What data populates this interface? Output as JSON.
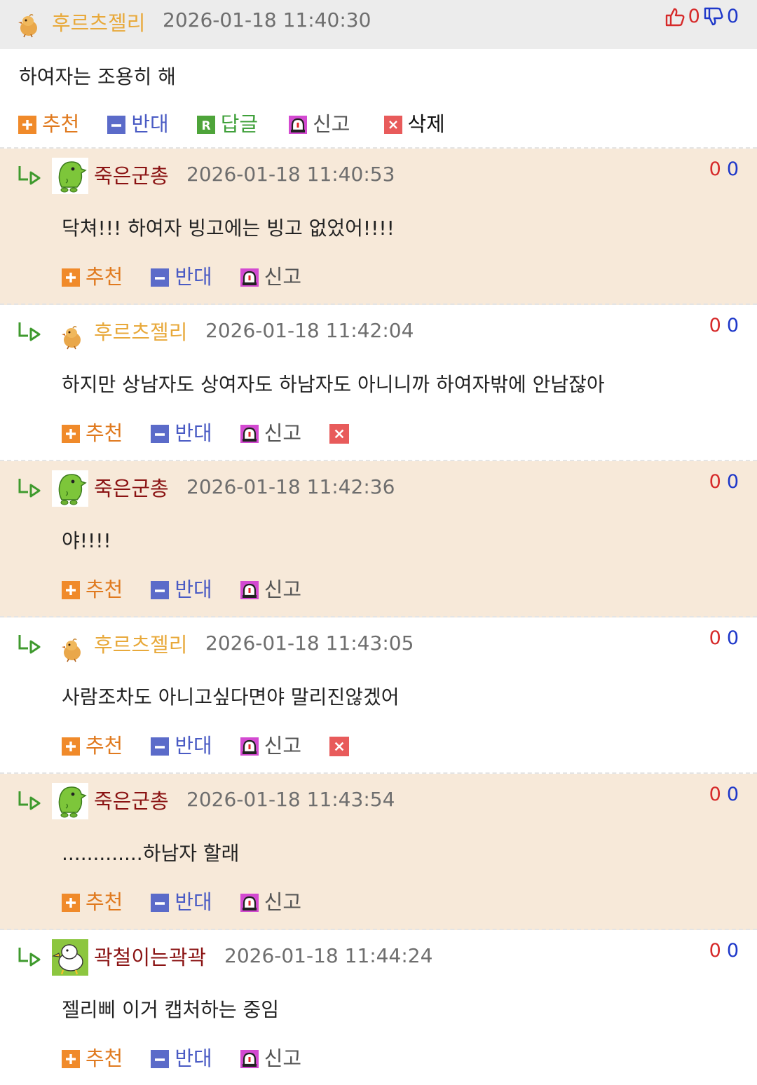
{
  "main": {
    "nickname": "후르츠젤리",
    "date": "2026-01-18 11:40:30",
    "up_count": "0",
    "down_count": "0",
    "text": "하여자는 조용히 해",
    "actions": {
      "recommend": "추천",
      "oppose": "반대",
      "reply": "답글",
      "report": "신고",
      "delete": "삭제"
    }
  },
  "reply_actions": {
    "recommend": "추천",
    "oppose": "반대",
    "report": "신고"
  },
  "replies": [
    {
      "nickname": "죽은군총",
      "date": "2026-01-18 11:40:53",
      "up": "0",
      "down": "0",
      "text": "닥쳐!!! 하여자 빙고에는 빙고 없었어!!!!"
    },
    {
      "nickname": "후르츠젤리",
      "date": "2026-01-18 11:42:04",
      "up": "0",
      "down": "0",
      "text": "하지만 상남자도 상여자도 하남자도 아니니까 하여자밖에 안남잖아"
    },
    {
      "nickname": "죽은군총",
      "date": "2026-01-18 11:42:36",
      "up": "0",
      "down": "0",
      "text": "야!!!!"
    },
    {
      "nickname": "후르츠젤리",
      "date": "2026-01-18 11:43:05",
      "up": "0",
      "down": "0",
      "text": "사람조차도 아니고싶다면야 말리진않겠어"
    },
    {
      "nickname": "죽은군총",
      "date": "2026-01-18 11:43:54",
      "up": "0",
      "down": "0",
      "text": ".............하남자 할래"
    },
    {
      "nickname": "곽철이는곽곽",
      "date": "2026-01-18 11:44:24",
      "up": "0",
      "down": "0",
      "text": "젤리삐 이거 캡처하는 중임"
    }
  ],
  "icons": {
    "recommend": "plus-square-icon",
    "oppose": "minus-square-icon",
    "reply": "r-square-icon",
    "report": "siren-icon",
    "delete": "x-square-icon",
    "thumb_up": "thumbs-up-icon",
    "thumb_down": "thumbs-down-icon",
    "reply_arrow": "reply-arrow-icon"
  },
  "colors": {
    "header_bg": "#ececec",
    "reply_beige_bg": "#f7e9d9",
    "nick_yellow": "#e8a93b",
    "nick_red": "#8a1212",
    "up_red": "#d62a2a",
    "down_blue": "#1d37c9"
  }
}
